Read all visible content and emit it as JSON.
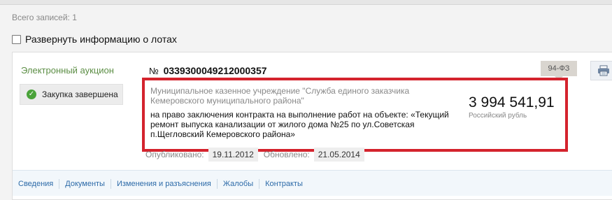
{
  "header": {
    "total_records": "Всего записей: 1"
  },
  "expand": {
    "label": "Развернуть информацию о лотах"
  },
  "card": {
    "auction_type": "Электронный аукцион",
    "status": "Закупка завершена",
    "number_sign": "№",
    "number": "0339300049212000357",
    "law_tag": "94-ФЗ",
    "customer": "Муниципальное казенное учреждение \"Служба единого заказчика Кемеровского муниципального района\"",
    "purpose": "на право заключения контракта на выполнение работ на объекте: «Текущий ремонт выпуска канализации от жилого дома №25 по ул.Советская п.Щегловский Кемеровского района»",
    "price": "3 994 541,91",
    "currency": "Российский рубль",
    "published_label": "Опубликовано:",
    "published_date": "19.11.2012",
    "updated_label": "Обновлено:",
    "updated_date": "21.05.2014"
  },
  "tabs": [
    {
      "label": "Сведения"
    },
    {
      "label": "Документы"
    },
    {
      "label": "Изменения и разъяснения"
    },
    {
      "label": "Жалобы"
    },
    {
      "label": "Контракты"
    }
  ],
  "colors": {
    "highlight": "#d4232d",
    "link": "#2c6aa8",
    "auction_type": "#5c8e45",
    "status_ok": "#4aa33a"
  },
  "icons": {
    "status": "check-circle-icon",
    "print": "print-icon",
    "expand": "checkbox-icon"
  }
}
